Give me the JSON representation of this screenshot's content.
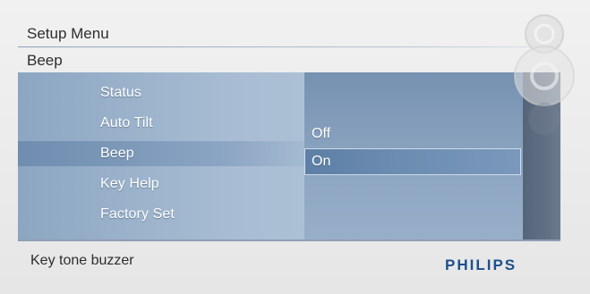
{
  "header": {
    "title": "Setup Menu",
    "subtitle": "Beep"
  },
  "menu": {
    "items": [
      "Status",
      "Auto Tilt",
      "Beep",
      "Key Help",
      "Factory Set"
    ],
    "selected_index": 2
  },
  "submenu": {
    "options": [
      "Off",
      "On"
    ],
    "selected_index": 1
  },
  "footer": {
    "description": "Key tone buzzer",
    "brand": "PHILIPS"
  },
  "colors": {
    "brand": "#1d4f8c",
    "panel": "#9db4cc",
    "highlight": "#6b8bb0",
    "side_strip": "#5c6b80"
  },
  "icons": [
    "control-buttons-icon"
  ]
}
